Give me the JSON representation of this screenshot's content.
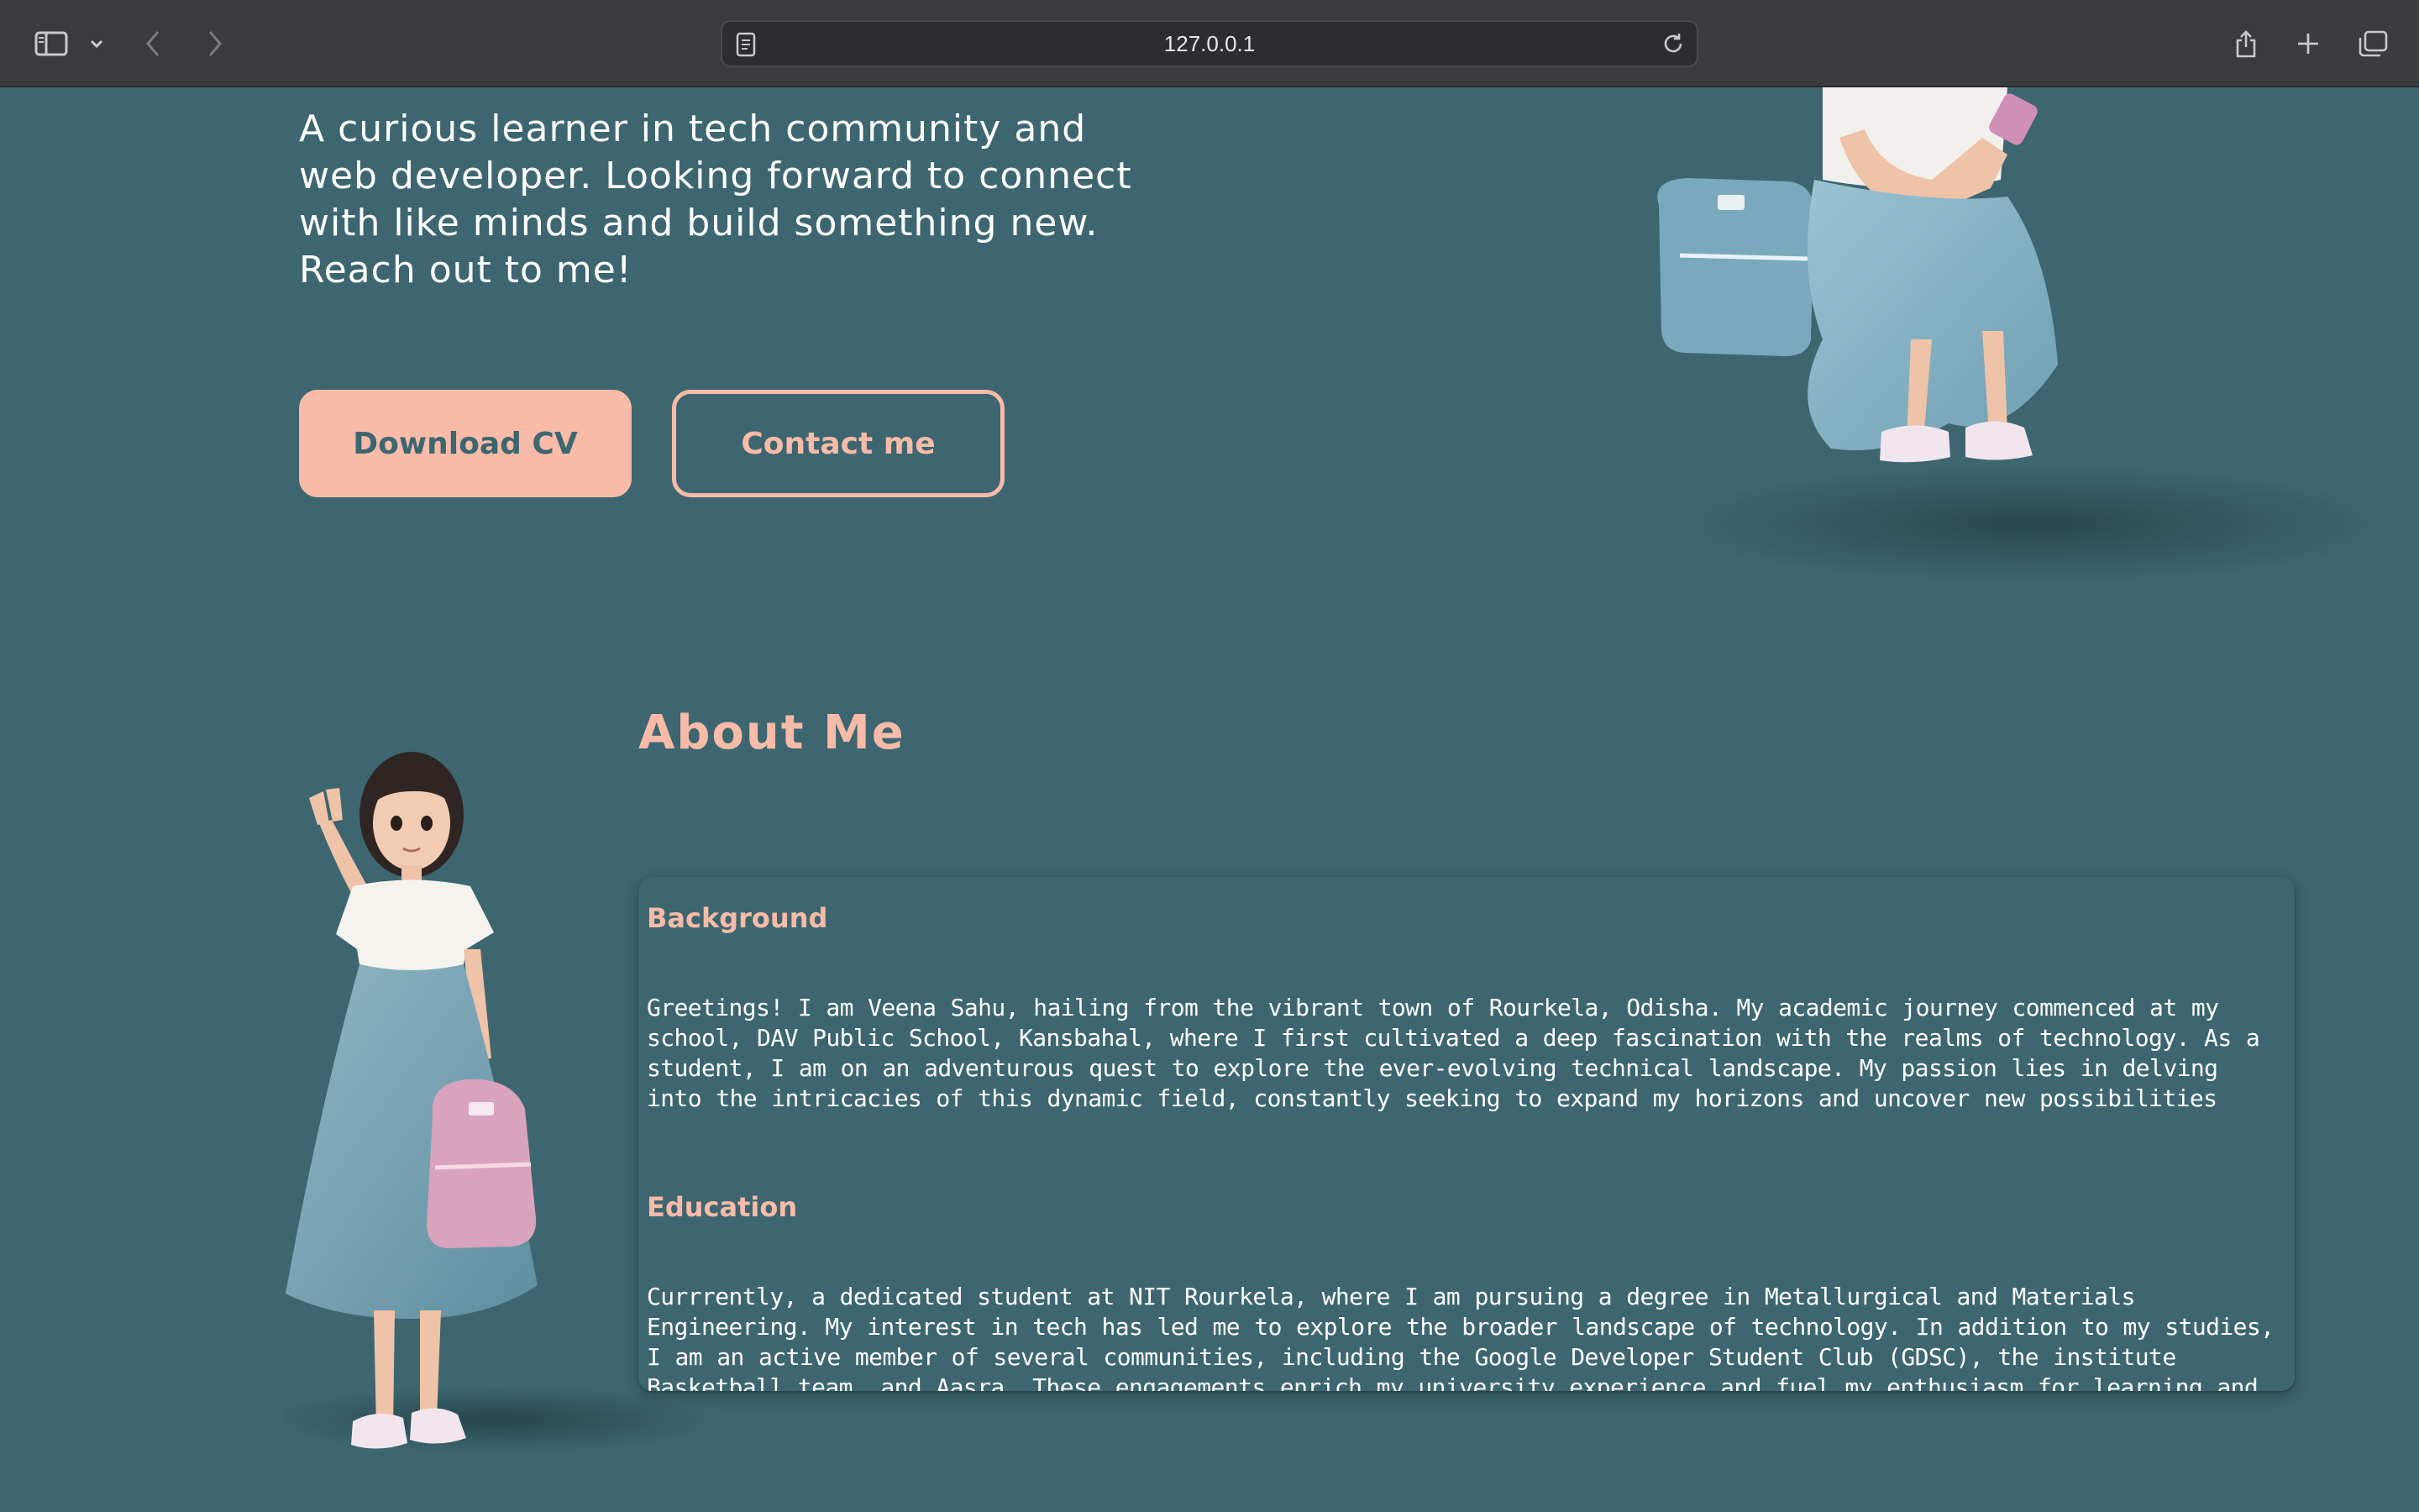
{
  "browser": {
    "url": "127.0.0.1",
    "icons": [
      "sidebar-icon",
      "chevron-down-icon",
      "back-icon",
      "forward-icon",
      "page-icon",
      "reload-icon",
      "share-icon",
      "plus-icon",
      "tabs-icon"
    ]
  },
  "hero": {
    "intro": "A curious learner in tech community and web developer. Looking forward to connect with like minds and build something new. Reach out to me!",
    "download_label": "Download CV",
    "contact_label": "Contact me"
  },
  "about": {
    "title": "About Me",
    "sections": [
      {
        "title": "Background",
        "body": "Greetings! I am Veena Sahu, hailing from the vibrant town of Rourkela, Odisha. My academic journey commenced at my school, DAV Public School, Kansbahal, where I first cultivated a deep fascination with the realms of technology. As a student, I am on an adventurous quest to explore the ever-evolving technical landscape. My passion lies in delving into the intricacies of this dynamic field, constantly seeking to expand my horizons and uncover new possibilities"
      },
      {
        "title": "Education",
        "body": "Currrently, a dedicated student at NIT Rourkela, where I am pursuing a degree in Metallurgical and Materials Engineering. My interest in tech has led me to explore the broader landscape of technology. In addition to my studies, I am an active member of several communities, including the Google Developer Student Club (GDSC), the institute Basketball team, and Aasra. These engagements enrich my university experience and fuel my enthusiasm for learning and collaboration."
      }
    ]
  },
  "colors": {
    "background": "#3d6670",
    "accent": "#f7bba7",
    "chrome": "#3a3b3e",
    "text": "#ffffff"
  }
}
